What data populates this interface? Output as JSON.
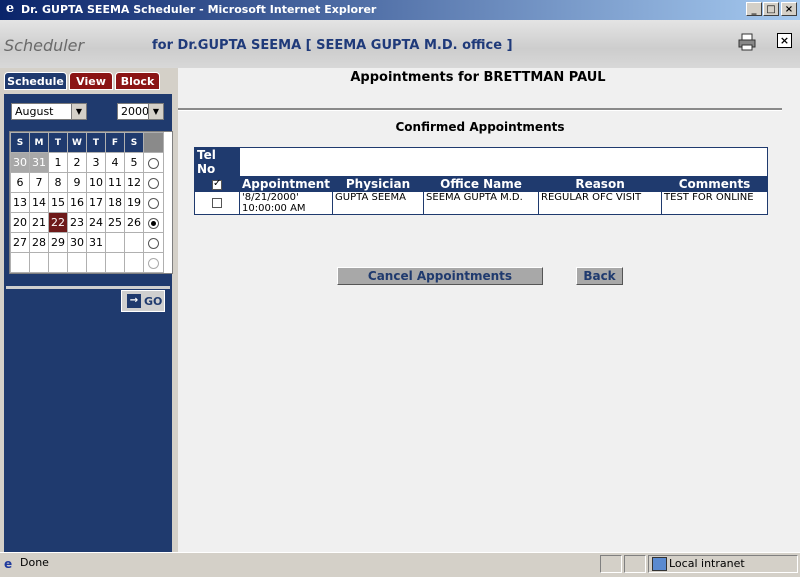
{
  "window": {
    "title": "Dr. GUPTA SEEMA Scheduler - Microsoft Internet Explorer",
    "controls": {
      "minimize": "_",
      "maximize": "□",
      "close": "×"
    }
  },
  "header": {
    "logo": "Scheduler",
    "doctor_line": "for Dr.GUPTA SEEMA [ SEEMA GUPTA M.D. office ]",
    "close_label": "×"
  },
  "sidebar": {
    "tabs": [
      {
        "label": "Schedule"
      },
      {
        "label": "View"
      },
      {
        "label": "Block"
      }
    ],
    "month": "August",
    "year": "2000",
    "go_label": "GO",
    "go_icon": "→",
    "weekdays": [
      "S",
      "M",
      "T",
      "W",
      "T",
      "F",
      "S"
    ],
    "weeks": [
      [
        "30",
        "31",
        "1",
        "2",
        "3",
        "4",
        "5"
      ],
      [
        "6",
        "7",
        "8",
        "9",
        "10",
        "11",
        "12"
      ],
      [
        "13",
        "14",
        "15",
        "16",
        "17",
        "18",
        "19"
      ],
      [
        "20",
        "21",
        "22",
        "23",
        "24",
        "25",
        "26"
      ],
      [
        "27",
        "28",
        "29",
        "30",
        "31",
        "",
        ""
      ],
      [
        "",
        "",
        "",
        "",
        "",
        "",
        ""
      ]
    ],
    "selected_week": 4,
    "today": "22"
  },
  "main": {
    "title": "Appointments for BRETTMAN PAUL",
    "section": "Confirmed Appointments",
    "tel_label": "Tel No",
    "tel_value": "",
    "columns": [
      "Appointment",
      "Physician",
      "Office Name",
      "Reason",
      "Comments"
    ],
    "rows": [
      {
        "appointment": "'8/21/2000' 10:00:00 AM",
        "physician": "GUPTA SEEMA",
        "office": "SEEMA GUPTA M.D.",
        "reason": "REGULAR OFC VISIT",
        "comments": "TEST FOR ONLINE"
      }
    ],
    "cancel_label": "Cancel Appointments",
    "back_label": "Back"
  },
  "status": {
    "text": "Done",
    "zone": "Local intranet"
  }
}
